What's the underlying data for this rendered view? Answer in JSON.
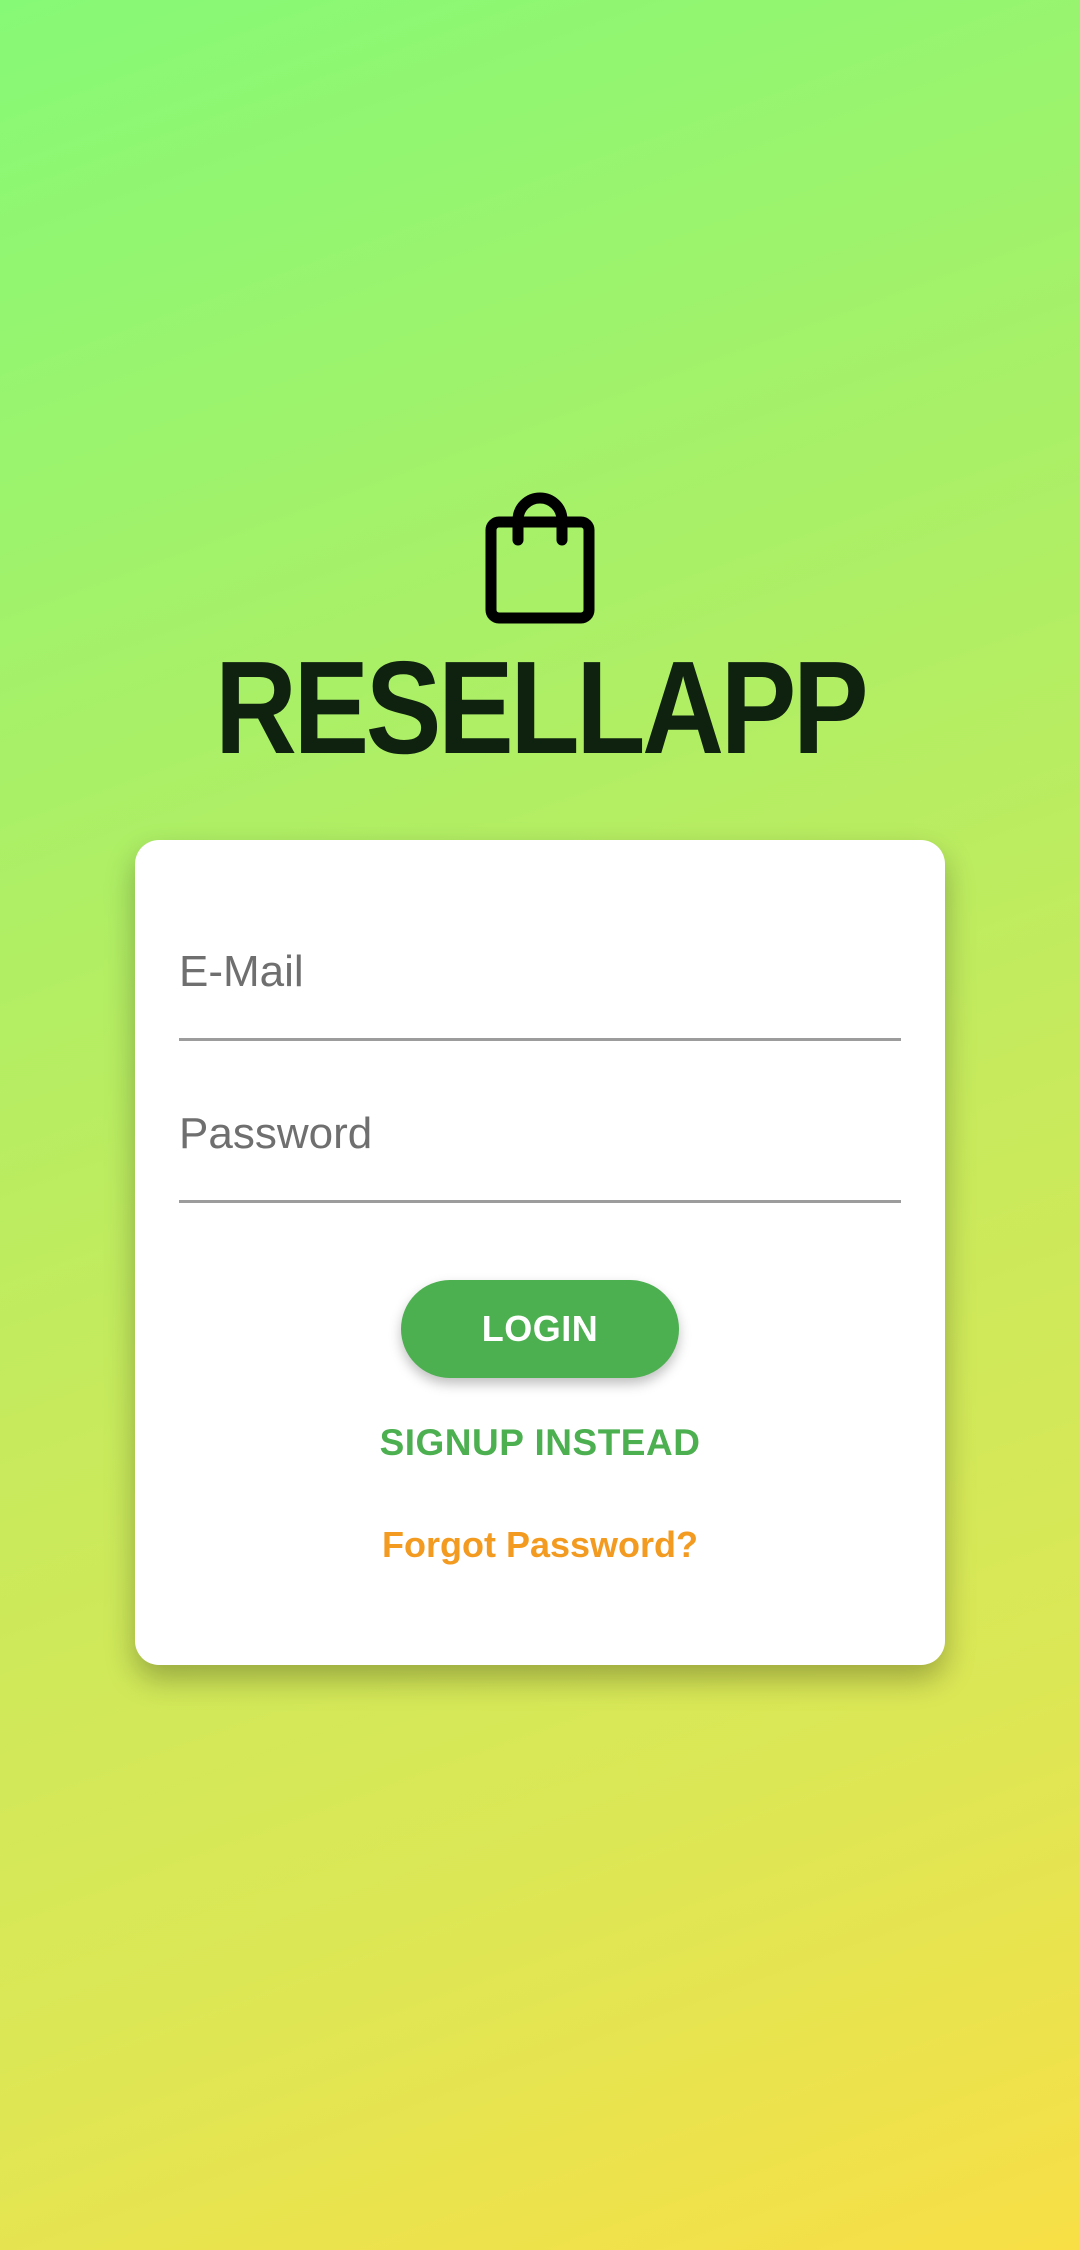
{
  "app": {
    "title": "RESELLAPP",
    "logo_icon": "shopping-bag-icon"
  },
  "login_form": {
    "email": {
      "value": "",
      "placeholder": "E-Mail"
    },
    "password": {
      "value": "",
      "placeholder": "Password"
    },
    "login_label": "LOGIN",
    "signup_label": "SIGNUP INSTEAD",
    "forgot_label": "Forgot Password?"
  },
  "colors": {
    "background_top": "#86f976",
    "background_bottom": "#f8df46",
    "title": "#0f2210",
    "primary": "#4caf50",
    "forgot_link": "#f39a21",
    "card": "#ffffff"
  }
}
